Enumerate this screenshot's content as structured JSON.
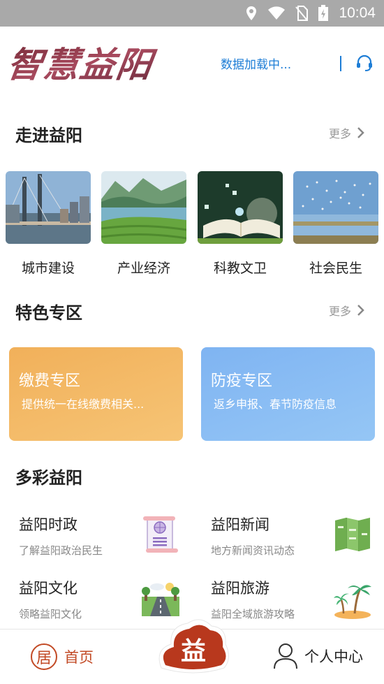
{
  "status_bar": {
    "time": "10:04",
    "icons": [
      "location-icon",
      "wifi-icon",
      "no-sim-icon",
      "battery-charging-icon"
    ]
  },
  "header": {
    "logo_text": "智慧益阳",
    "loading_text": "数据加载中...",
    "service_icon": "headset-icon"
  },
  "section_explore": {
    "title": "走进益阳",
    "more": "更多",
    "categories": [
      {
        "label": "城市建设",
        "image": "city-bridge-photo"
      },
      {
        "label": "产业经济",
        "image": "tea-hills-lake-photo"
      },
      {
        "label": "科教文卫",
        "image": "open-book-photo"
      },
      {
        "label": "社会民生",
        "image": "birds-wetland-photo"
      }
    ]
  },
  "section_feature": {
    "title": "特色专区",
    "more": "更多",
    "cards": [
      {
        "title": "缴费专区",
        "desc": "提供统一在线缴费相关...",
        "color": "#f3b25e"
      },
      {
        "title": "防疫专区",
        "desc": "返乡申报、春节防疫信息",
        "color": "#86baf3"
      }
    ]
  },
  "section_colorful": {
    "title": "多彩益阳",
    "items": [
      {
        "title": "益阳时政",
        "desc": "了解益阳政治民生",
        "icon": "scroll-document-icon"
      },
      {
        "title": "益阳新闻",
        "desc": "地方新闻资讯动态",
        "icon": "folded-map-icon"
      },
      {
        "title": "益阳文化",
        "desc": "领略益阳文化",
        "icon": "road-landscape-icon"
      },
      {
        "title": "益阳旅游",
        "desc": "益阳全域旅游攻略",
        "icon": "palm-island-icon"
      }
    ]
  },
  "tab_bar": {
    "home_label": "首页",
    "home_glyph": "居",
    "center_glyph": "益",
    "profile_label": "个人中心",
    "accent": "#c24a25"
  }
}
